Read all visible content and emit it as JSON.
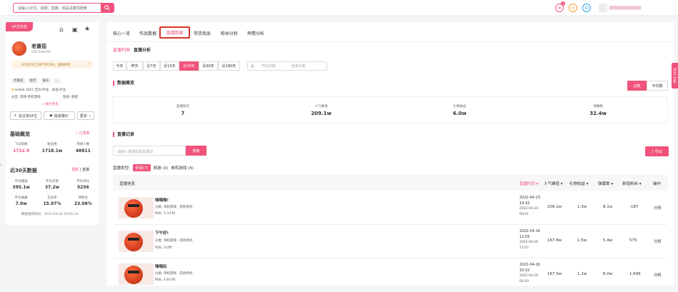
{
  "search": {
    "placeholder": "请输入UP主、视频、直播、商品关键词搜索"
  },
  "top": {
    "msg_badge": "1",
    "user_name": "▆▆▆▆▆▆▆▆▆▆▆▆"
  },
  "sidebar": {
    "badge": "UP主信息",
    "name": "老番茄",
    "uid": "UID:546195",
    "promo": "UP主历史上榜TOP100，查看榜单",
    "tags": [
      "老番茄",
      "搞笑",
      "娱乐",
      "..."
    ],
    "honor": "bilibili 2021 百大UP主、知名UP主",
    "partition": "分区: 游戏-单机游戏",
    "gender": "性别: 保密",
    "expand": "∨ 展开更多",
    "btn_follow": "关注该UP主",
    "btn_report": "投放报价",
    "btn_more": "更多",
    "basic_title": "基础概览",
    "basic_updated": "已更新",
    "basic_stats": [
      {
        "label": "飞瓜指数",
        "value": "1732.9"
      },
      {
        "label": "粉丝数",
        "value": "1718.1w"
      },
      {
        "label": "周增人数",
        "value": "48811"
      }
    ],
    "recent_title": "近30天数据",
    "recent_links": [
      "视频",
      "直播"
    ],
    "recent_stats": [
      {
        "label": "平均播放",
        "value": "395.1w"
      },
      {
        "label": "平均点赞",
        "value": "37.2w"
      },
      {
        "label": "平均评论",
        "value": "5256"
      },
      {
        "label": "平均收藏",
        "value": "7.0w"
      },
      {
        "label": "互动率",
        "value": "15.97%"
      },
      {
        "label": "赞粉比",
        "value": "23.06%"
      }
    ],
    "update_time": "数据更新时间：2022-04-24 10:05:14"
  },
  "tabs": [
    "核心一览",
    "作品数据",
    "直播数据",
    "带货商品",
    "粉丝分析",
    "舆情分析"
  ],
  "subtabs": [
    "直播列表",
    "直播分析"
  ],
  "ranges": [
    "今天",
    "昨天",
    "近7天",
    "近15天",
    "近30天",
    "近90天",
    "近180天"
  ],
  "date": {
    "start": "开始日期",
    "sep": "-",
    "end": "结束日期"
  },
  "overview": {
    "title": "数据概览",
    "toggle": [
      "总数",
      "平均数"
    ],
    "stats": [
      {
        "label": "直播场次",
        "value": "7"
      },
      {
        "label": "人气峰值",
        "value": "209.1w"
      },
      {
        "label": "礼物收益",
        "value": "6.0w"
      },
      {
        "label": "弹幕数",
        "value": "32.4w"
      }
    ]
  },
  "records": {
    "title": "直播记录",
    "search_placeholder": "请输入直播标题关键词",
    "search_btn": "搜索",
    "export": "导出",
    "type_label": "直播类型:",
    "types": [
      "全部(7)",
      "网游 (3)",
      "单机游戏 (4)"
    ],
    "headers": [
      "直播信息",
      "直播时间 ▾",
      "人气峰值 ▾",
      "礼物收益 ▾",
      "弹幕数 ▾",
      "新增粉丝 ▾",
      "操作"
    ],
    "rows": [
      {
        "title": "嗨嗨嗨!",
        "category": "分类: 单机游戏 - 其他单机",
        "duration": "时长: 5.3小时",
        "start": "2022-04-23",
        "start_t": "19:32",
        "end": "2022-04-24",
        "end_t": "00:51",
        "peak": "209.1w",
        "gift": "1.3w",
        "danmu": "8.1w",
        "fans": "-187",
        "op": "分析"
      },
      {
        "title": "下午好!",
        "category": "分类: 单机游戏 - 其他单机",
        "duration": "时长: 5小时",
        "start": "2022-04-16",
        "start_t": "12:05",
        "end": "2022-04-16",
        "end_t": "17:07",
        "peak": "167.8w",
        "gift": "1.5w",
        "danmu": "5.4w",
        "fans": "575",
        "op": "分析"
      },
      {
        "title": "嗨嗨玩",
        "category": "分类: 单机游戏 - 其他单机",
        "duration": "时长: 4.8小时",
        "start": "2022-04-16",
        "start_t": "19:32",
        "end": "2022-04-16",
        "end_t": "00:19",
        "peak": "167.5w",
        "gift": "1.2w",
        "danmu": "8.0w",
        "fans": "1,646",
        "op": "分析"
      }
    ]
  },
  "float_btn": "对比 分析",
  "colors": {
    "accent": "#f0537c",
    "header_bg": "#ffffff",
    "page_bg": "#f4f5f7"
  }
}
